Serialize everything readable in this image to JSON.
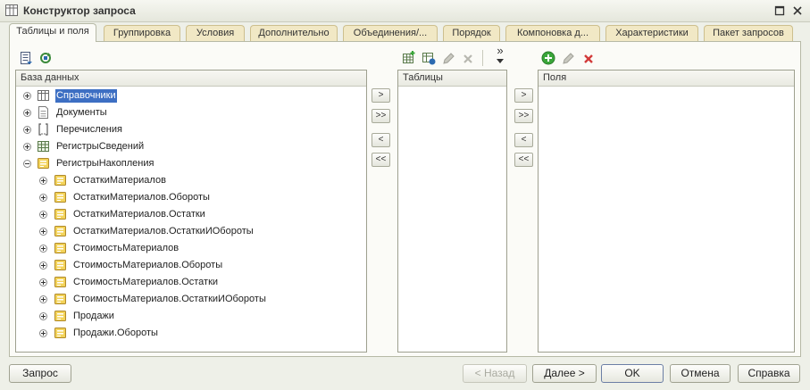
{
  "window": {
    "title": "Конструктор запроса"
  },
  "tabs": [
    {
      "label": "Таблицы и поля",
      "active": true
    },
    {
      "label": "Группировка"
    },
    {
      "label": "Условия"
    },
    {
      "label": "Дополнительно"
    },
    {
      "label": "Объединения/..."
    },
    {
      "label": "Порядок"
    },
    {
      "label": "Компоновка д..."
    },
    {
      "label": "Характеристики"
    },
    {
      "label": "Пакет запросов"
    }
  ],
  "database_panel": {
    "header": "База данных",
    "tree": [
      {
        "label": "Справочники",
        "icon": "catalog-icon",
        "expanded": false,
        "selected": true
      },
      {
        "label": "Документы",
        "icon": "document-icon",
        "expanded": false
      },
      {
        "label": "Перечисления",
        "icon": "enum-icon",
        "expanded": false
      },
      {
        "label": "РегистрыСведений",
        "icon": "info-register-icon",
        "expanded": false
      },
      {
        "label": "РегистрыНакопления",
        "icon": "accumulation-register-icon",
        "expanded": true,
        "children": [
          "ОстаткиМатериалов",
          "ОстаткиМатериалов.Обороты",
          "ОстаткиМатериалов.Остатки",
          "ОстаткиМатериалов.ОстаткиИОбороты",
          "СтоимостьМатериалов",
          "СтоимостьМатериалов.Обороты",
          "СтоимостьМатериалов.Остатки",
          "СтоимостьМатериалов.ОстаткиИОбороты",
          "Продажи",
          "Продажи.Обороты"
        ]
      }
    ]
  },
  "tables_panel": {
    "header": "Таблицы"
  },
  "fields_panel": {
    "header": "Поля"
  },
  "move_buttons": {
    "add": ">",
    "add_all": ">>",
    "remove": "<",
    "remove_all": "<<"
  },
  "toolbar_more": "»",
  "footer": {
    "query_label": "Запрос",
    "back_label": "< Назад",
    "next_label": "Далее >",
    "ok_label": "OK",
    "cancel_label": "Отмена",
    "help_label": "Справка"
  },
  "colors": {
    "selection": "#3d6fc3",
    "tab_inactive": "#f1e8c5",
    "panel_border": "#9ea08f",
    "add_icon": "#3aa63a",
    "delete_icon": "#d23a3a"
  }
}
